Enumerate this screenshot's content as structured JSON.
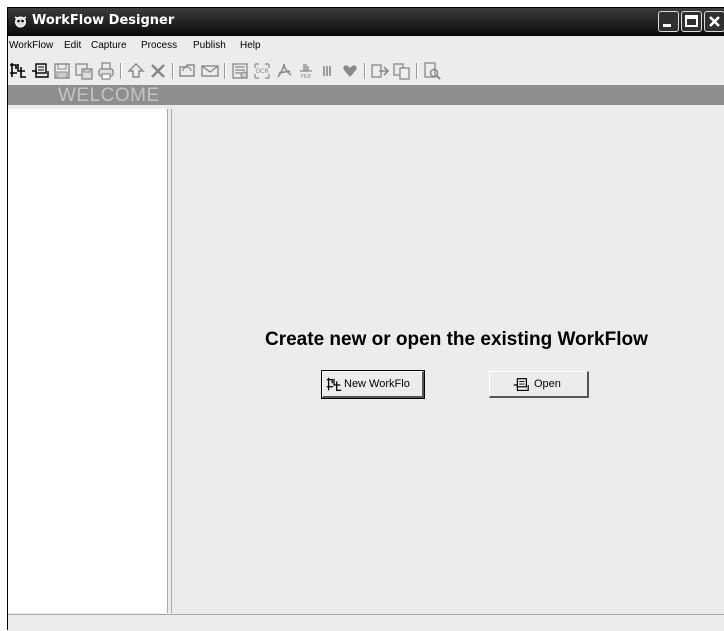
{
  "window": {
    "title": "WorkFlow Designer"
  },
  "menu": [
    "WorkFlow",
    "Edit",
    "Capture",
    "Process",
    "Publish",
    "Help"
  ],
  "toolbar": {
    "icons": [
      "new-workflow-icon",
      "open-icon",
      "save-icon",
      "save-as-icon",
      "print-icon",
      "move-up-icon",
      "delete-icon",
      "folder-icon",
      "mail-icon",
      "scan-icon",
      "ocr-icon",
      "pdf-icon",
      "barcode-icon",
      "heart-icon",
      "forward-icon",
      "copy-icon",
      "preview-icon"
    ]
  },
  "banner": {
    "text": "WELCOME"
  },
  "main": {
    "heading": "Create new or open the existing WorkFlow",
    "new_button_label": "New WorkFlo",
    "open_button_label": "Open"
  }
}
